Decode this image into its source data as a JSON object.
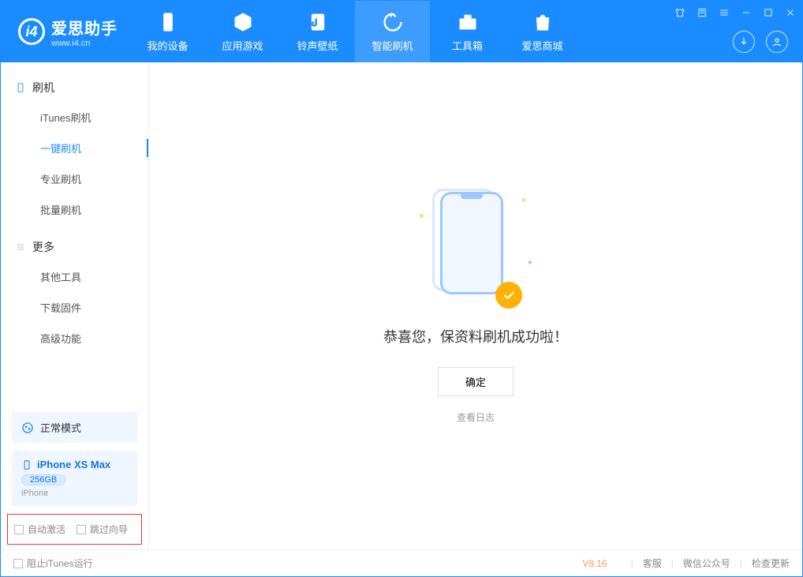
{
  "app": {
    "name": "爱思助手",
    "url": "www.i4.cn"
  },
  "nav": {
    "items": [
      {
        "id": "device",
        "label": "我的设备"
      },
      {
        "id": "apps",
        "label": "应用游戏"
      },
      {
        "id": "rings",
        "label": "铃声壁纸"
      },
      {
        "id": "flash",
        "label": "智能刷机"
      },
      {
        "id": "toolbox",
        "label": "工具箱"
      },
      {
        "id": "store",
        "label": "爱思商城"
      }
    ]
  },
  "sidebar": {
    "group1": {
      "title": "刷机",
      "items": [
        {
          "id": "itunes",
          "label": "iTunes刷机"
        },
        {
          "id": "oneclick",
          "label": "一键刷机"
        },
        {
          "id": "pro",
          "label": "专业刷机"
        },
        {
          "id": "batch",
          "label": "批量刷机"
        }
      ]
    },
    "group2": {
      "title": "更多",
      "items": [
        {
          "id": "other",
          "label": "其他工具"
        },
        {
          "id": "fw",
          "label": "下载固件"
        },
        {
          "id": "adv",
          "label": "高级功能"
        }
      ]
    }
  },
  "status_box": {
    "label": "正常模式"
  },
  "device": {
    "name": "iPhone XS Max",
    "capacity": "256GB",
    "type": "iPhone"
  },
  "checks": {
    "auto_activate": "自动激活",
    "skip_guide": "跳过向导"
  },
  "main": {
    "msg": "恭喜您，保资料刷机成功啦！",
    "ok": "确定",
    "log": "查看日志"
  },
  "statusbar": {
    "block_itunes": "阻止iTunes运行",
    "version": "V8.16",
    "support": "客服",
    "wechat": "微信公众号",
    "update": "检查更新"
  }
}
